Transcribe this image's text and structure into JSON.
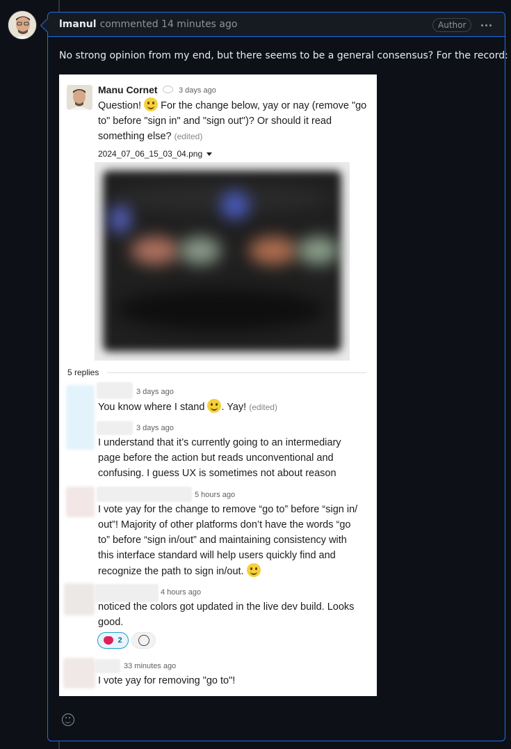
{
  "comment": {
    "author": "lmanul",
    "meta": "commented 14 minutes ago",
    "badge": "Author",
    "text": "No strong opinion from my end, but there seems to be a general consensus? For the record:"
  },
  "screenshot": {
    "main_message": {
      "name": "Manu Cornet",
      "time": "3 days ago",
      "text_a": "Question!",
      "text_b": "For the change below, yay or nay (remove \"go",
      "line2": "to\" before \"sign in\" and \"sign out\")? Or should it read",
      "line3": "something else?",
      "edited": "(edited)",
      "file_name": "2024_07_06_15_03_04.png"
    },
    "replies_label": "5 replies",
    "replies": [
      {
        "time": "3 days ago",
        "text_a": "You know where I stand",
        "text_b": ". Yay!",
        "edited": "(edited)"
      },
      {
        "time": "3 days ago",
        "lines": [
          "I understand that it’s currently going to an intermediary",
          "page before the action but reads unconventional and",
          "confusing. I guess UX is sometimes not about reason"
        ]
      },
      {
        "time": "5 hours ago",
        "lines": [
          "I vote yay for the change to remove “go to” before “sign in/",
          "out”! Majority of other platforms don’t have the words “go",
          "to” before “sign in/out” and maintaining consistency with",
          "this interface standard will help users quickly find and",
          "recognize the path to sign in/out."
        ]
      },
      {
        "time": "4 hours ago",
        "lines": [
          "noticed the colors got updated in the live dev build. Looks",
          "good."
        ],
        "reaction_count": "2"
      },
      {
        "time": "33 minutes ago",
        "lines": [
          "I vote yay for removing \"go to\"!"
        ]
      }
    ]
  },
  "icons": {
    "header_menu": "kebab-horizontal-icon",
    "footer": "smiley-icon"
  }
}
